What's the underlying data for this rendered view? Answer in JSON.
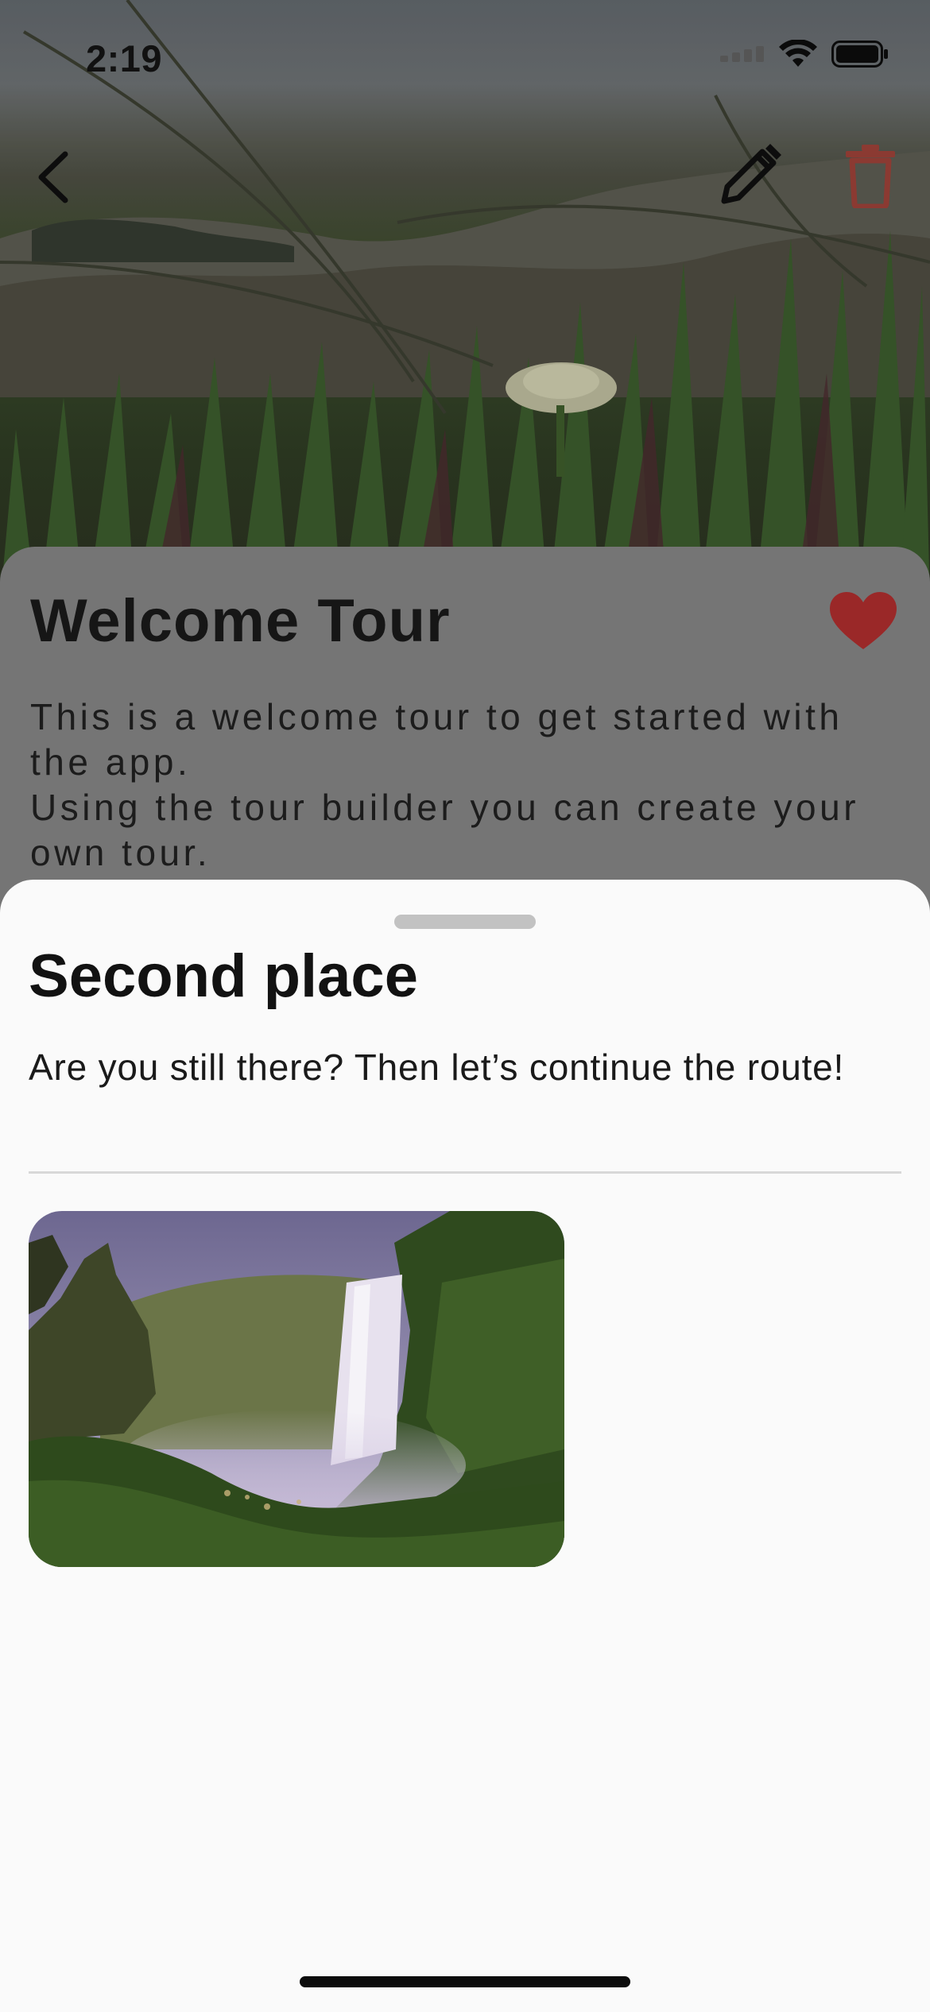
{
  "status_bar": {
    "time": "2:19",
    "icons": [
      "cellular-signal-icon",
      "wifi-icon",
      "battery-icon"
    ]
  },
  "nav": {
    "back_icon": "chevron-left-icon",
    "edit_icon": "pencil-icon",
    "delete_icon": "trash-icon"
  },
  "tour": {
    "title": "Welcome Tour",
    "description": "This is a welcome tour to get started with the app.\nUsing the tour builder you can create your own tour.",
    "favorite_icon": "heart-icon"
  },
  "sheet": {
    "title": "Second place",
    "description": "Are you still there? Then let’s continue the route!",
    "image_subject": "waterfall-photo"
  },
  "colors": {
    "delete_accent": "#8b3a32",
    "favorite_accent": "#9a2828",
    "sheet_background": "#fafafa",
    "overlay_card": "#757575"
  }
}
